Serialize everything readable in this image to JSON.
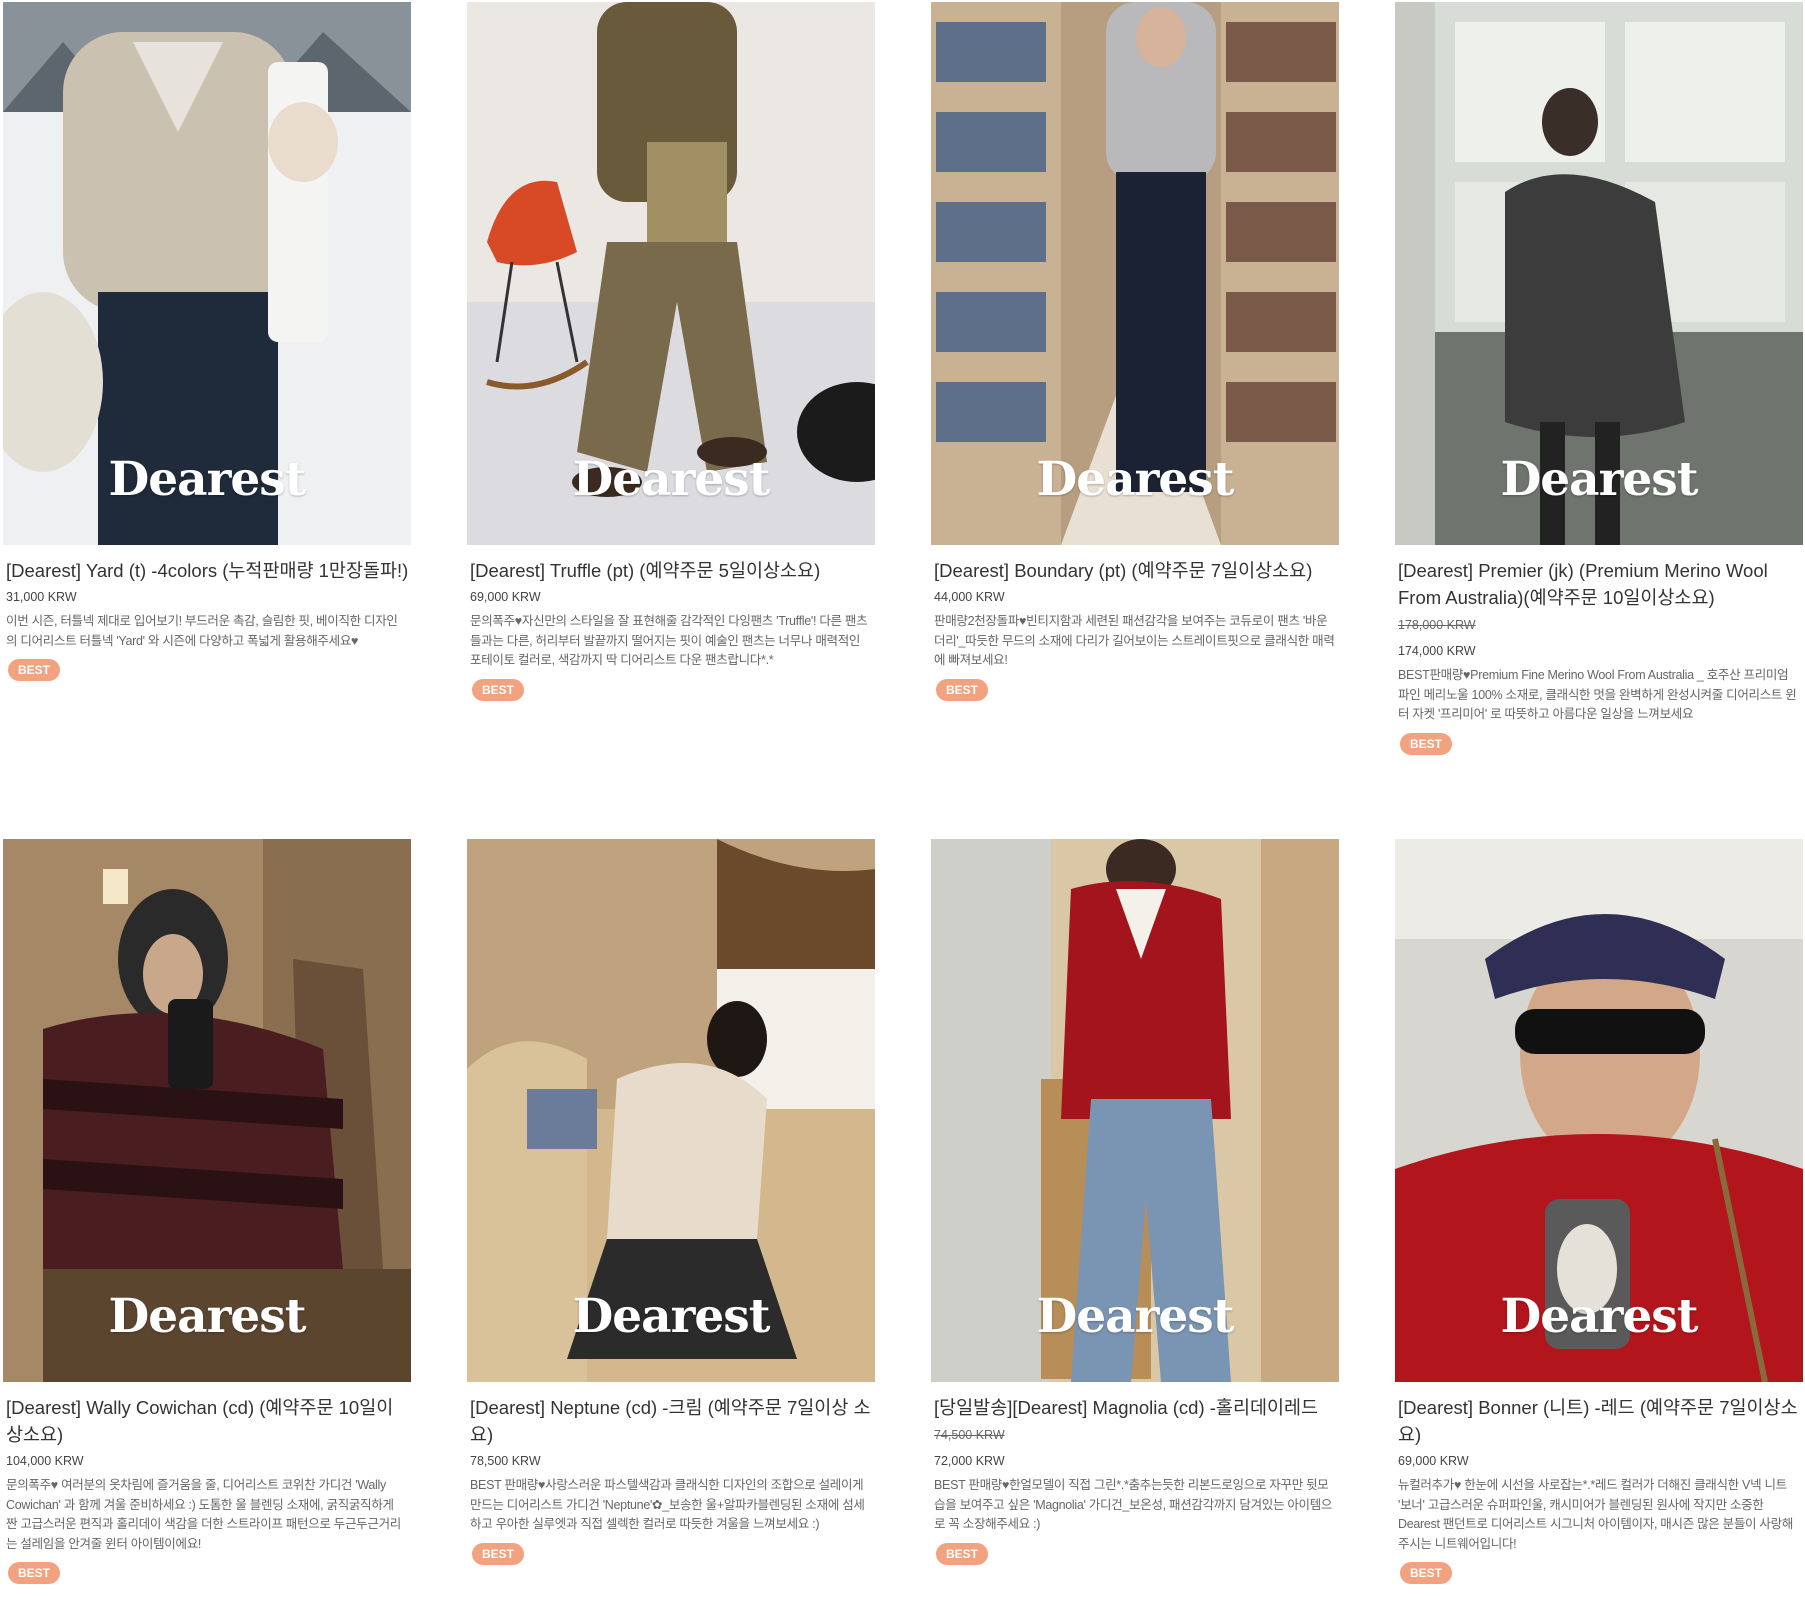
{
  "brand_watermark": "Dearest",
  "badge_color": "#f2a27f",
  "products": [
    {
      "title": "[Dearest] Yard (t) -4colors (누적판매량 1만장돌파!)",
      "original_price": "",
      "price": "31,000 KRW",
      "description": "이번 시즌, 터틀넥 제대로 입어보기! 부드러운 촉감, 슬림한 핏, 베이직한 디자인의 디어리스트 터틀넥 'Yard' 와 시즌에 다양하고 폭넓게 활용해주세요♥",
      "badge": "BEST",
      "image": {
        "bg": "#dfe2e6",
        "subject": "#cbc1b1",
        "accent": "#1f2a3a",
        "scene": "snow"
      }
    },
    {
      "title": "[Dearest] Truffle (pt) (예약주문 5일이상소요)",
      "original_price": "",
      "price": "69,000 KRW",
      "description": "문의폭주♥자신만의 스타일을 잘 표현해줄 감각적인 다잉팬츠 'Truffle'! 다른 팬츠들과는 다른, 허리부터 발끝까지 떨어지는 핏이 예술인 팬츠는 너무나 매력적인 포테이토 컬러로, 색감까지 딱 디어리스트 다운 팬츠랍니다*.*",
      "badge": "BEST",
      "image": {
        "bg": "#e9e5e1",
        "subject": "#7a6a4c",
        "accent": "#d84a25",
        "scene": "studio"
      }
    },
    {
      "title": "[Dearest] Boundary (pt) (예약주문 7일이상소요)",
      "original_price": "",
      "price": "44,000 KRW",
      "description": "판매량2천장돌파♥빈티지함과 세련된 패션감각을 보여주는 코듀로이 팬츠 '바운더리'_따듯한 무드의 소재에 다리가 길어보이는 스트레이트핏으로 클래식한 매력에 빠져보세요!",
      "badge": "BEST",
      "image": {
        "bg": "#b79e80",
        "subject": "#1b2233",
        "accent": "#b9b9bb",
        "scene": "library"
      }
    },
    {
      "title": "[Dearest] Premier (jk) (Premium Merino Wool From Australia)(예약주문 10일이상소요)",
      "original_price": "178,000 KRW",
      "price": "174,000 KRW",
      "description": "BEST판매량♥Premium Fine Merino Wool From Australia _ 호주산 프리미엄 파인 메리노울 100% 소재로, 클래식한 멋을 완벽하게 완성시켜줄 디어리스트 윈터 자켓 '프리미어' 로 따뜻하고 아름다운 일상을 느껴보세요",
      "badge": "BEST",
      "image": {
        "bg": "#9aa09a",
        "subject": "#3c3c3c",
        "accent": "#e8eae4",
        "scene": "window"
      }
    },
    {
      "title": "[Dearest] Wally Cowichan (cd) (예약주문 10일이상소요)",
      "original_price": "",
      "price": "104,000 KRW",
      "description": "문의폭주♥ 여러분의 옷차림에 즐거움을 줄, 디어리스트 코위찬 가디건 'Wally Cowichan' 과 함께 겨울 준비하세요 :) 도톰한 울 블렌딩 소재에, 굵직굵직하게 짠 고급스러운 편직과 홀리데이 색감을 더한 스트라이프 패턴으로 두근두근거리는 설레임을 안겨줄 윈터 아이템이에요!",
      "badge": "BEST",
      "image": {
        "bg": "#a58866",
        "subject": "#4a1e20",
        "accent": "#1a1a1a",
        "scene": "room"
      }
    },
    {
      "title": "[Dearest] Neptune (cd) -크림 (예약주문 7일이상 소요)",
      "original_price": "",
      "price": "78,500 KRW",
      "description": "BEST 판매량♥사랑스러운 파스텔색감과 클래식한 디자인의 조합으로 설레이게 만드는 디어리스트 가디건 'Neptune'✿_보송한 울+알파카블렌딩된 소재에 섬세하고 우아한 실루엣과 직접 셀렉한 컬러로 따듯한 겨울을 느껴보세요 :)",
      "badge": "BEST",
      "image": {
        "bg": "#bfa27e",
        "subject": "#e7dccb",
        "accent": "#2b2b2b",
        "scene": "bed"
      }
    },
    {
      "title": "[당일발송][Dearest] Magnolia (cd) -홀리데이레드",
      "original_price": "74,500 KRW",
      "price": "72,000 KRW",
      "description": "BEST 판매량♥한얼모델이 직접 그린*.*춤추는듯한 리본드로잉으로 자꾸만 뒷모습을 보여주고 싶은 'Magnolia' 가디건_보온성, 패션감각까지 담겨있는 아이템으로 꼭 소장해주세요 :)",
      "badge": "BEST",
      "image": {
        "bg": "#d9c7a6",
        "subject": "#a3141c",
        "accent": "#7a94b3",
        "scene": "door"
      }
    },
    {
      "title": "[Dearest] Bonner (니트) -레드 (예약주문 7일이상소요)",
      "original_price": "",
      "price": "69,000 KRW",
      "description": "뉴컬러추가♥ 한눈에 시선을 사로잡는*.*레드 컬러가 더해진 클래식한 V넥 니트 '보너' 고급스러운 슈퍼파인울, 캐시미어가 블렌딩된 원사에 작지만 소중한 Dearest 팬던트로 디어리스트 시그니처 아이템이자, 매시즌 많은 분들이 사랑해주시는 니트웨어입니다!",
      "badge": "BEST",
      "image": {
        "bg": "#d8d6d0",
        "subject": "#b3151c",
        "accent": "#2f2f55",
        "scene": "selfie"
      }
    }
  ]
}
